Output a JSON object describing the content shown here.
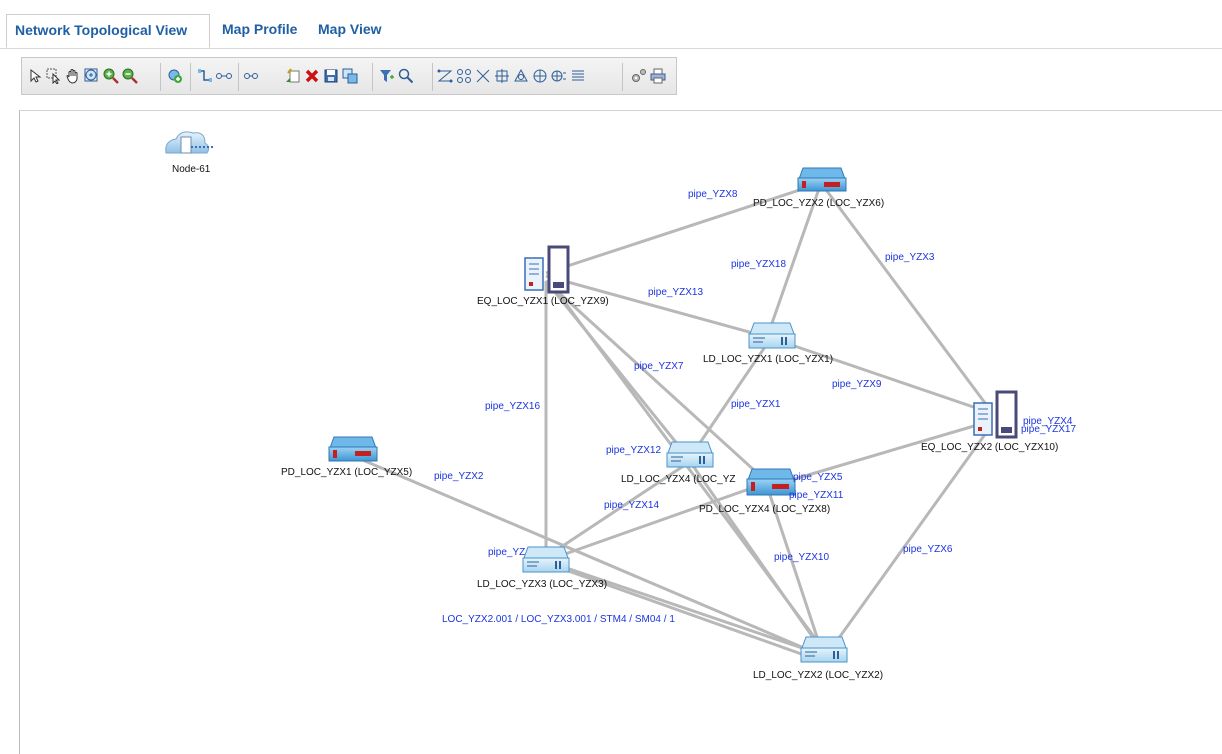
{
  "tabs": [
    {
      "label": "Network Topological View"
    },
    {
      "label": "Map Profile"
    },
    {
      "label": "Map View"
    }
  ],
  "toolbar": {
    "icons": [
      "select-arrow-icon",
      "select-region-icon",
      "pan-hand-icon",
      "zoom-fit-icon",
      "zoom-in-icon",
      "zoom-out-icon",
      "add-node-icon",
      "add-link-icon",
      "connect-icon",
      "link-icon",
      "new-map-icon",
      "delete-icon",
      "save-icon",
      "copy-icon",
      "filter-icon",
      "find-icon",
      "layout-icon",
      "layout-2-icon",
      "layout-3-icon",
      "layout-4-icon",
      "layout-5-icon",
      "layout-6-icon",
      "layout-7-icon",
      "layout-8-icon",
      "settings-icon",
      "print-icon"
    ]
  },
  "nodes": {
    "node61": "Node-61",
    "pd_yzx2": "PD_LOC_YZX2 (LOC_YZX6)",
    "eq_yzx1": "EQ_LOC_YZX1 (LOC_YZX9)",
    "ld_yzx1": "LD_LOC_YZX1 (LOC_YZX1)",
    "eq_yzx2": "EQ_LOC_YZX2 (LOC_YZX10)",
    "pd_yzx1": "PD_LOC_YZX1 (LOC_YZX5)",
    "ld_yzx4": "LD_LOC_YZX4 (LOC_YZ",
    "pd_yzx3": "PD_LOC_YZX4 (LOC_YZX8)",
    "ld_yzx3": "LD_LOC_YZX3 (LOC_YZX3)",
    "ld_yzx2": "LD_LOC_YZX2 (LOC_YZX2)"
  },
  "links": {
    "pipe_yzx8": "pipe_YZX8",
    "pipe_yzx18": "pipe_YZX18",
    "pipe_yzx3": "pipe_YZX3",
    "pipe_yzx13": "pipe_YZX13",
    "pipe_yzx7": "pipe_YZX7",
    "pipe_yzx9": "pipe_YZX9",
    "pipe_yzx16": "pipe_YZX16",
    "pipe_yzx1": "pipe_YZX1",
    "pipe_yzx4": "pipe_YZX4",
    "pipe_yzx17": "pipe_YZX17",
    "pipe_yzx12": "pipe_YZX12",
    "pipe_yzx5": "pipe_YZX5",
    "pipe_yzx11": "pipe_YZX11",
    "pipe_yzx2": "pipe_YZX2",
    "pipe_yzx14": "pipe_YZX14",
    "pipe_yz": "pipe_YZ",
    "pipe_yzx10": "pipe_YZX10",
    "pipe_yzx6": "pipe_YZX6",
    "stm_label": "LOC_YZX2.001 / LOC_YZX3.001 / STM4 / SM04 / 1"
  },
  "colors": {
    "tab_text": "#1f5fa3",
    "link_label": "#1a34e0",
    "link_line": "#b8b8b8"
  }
}
